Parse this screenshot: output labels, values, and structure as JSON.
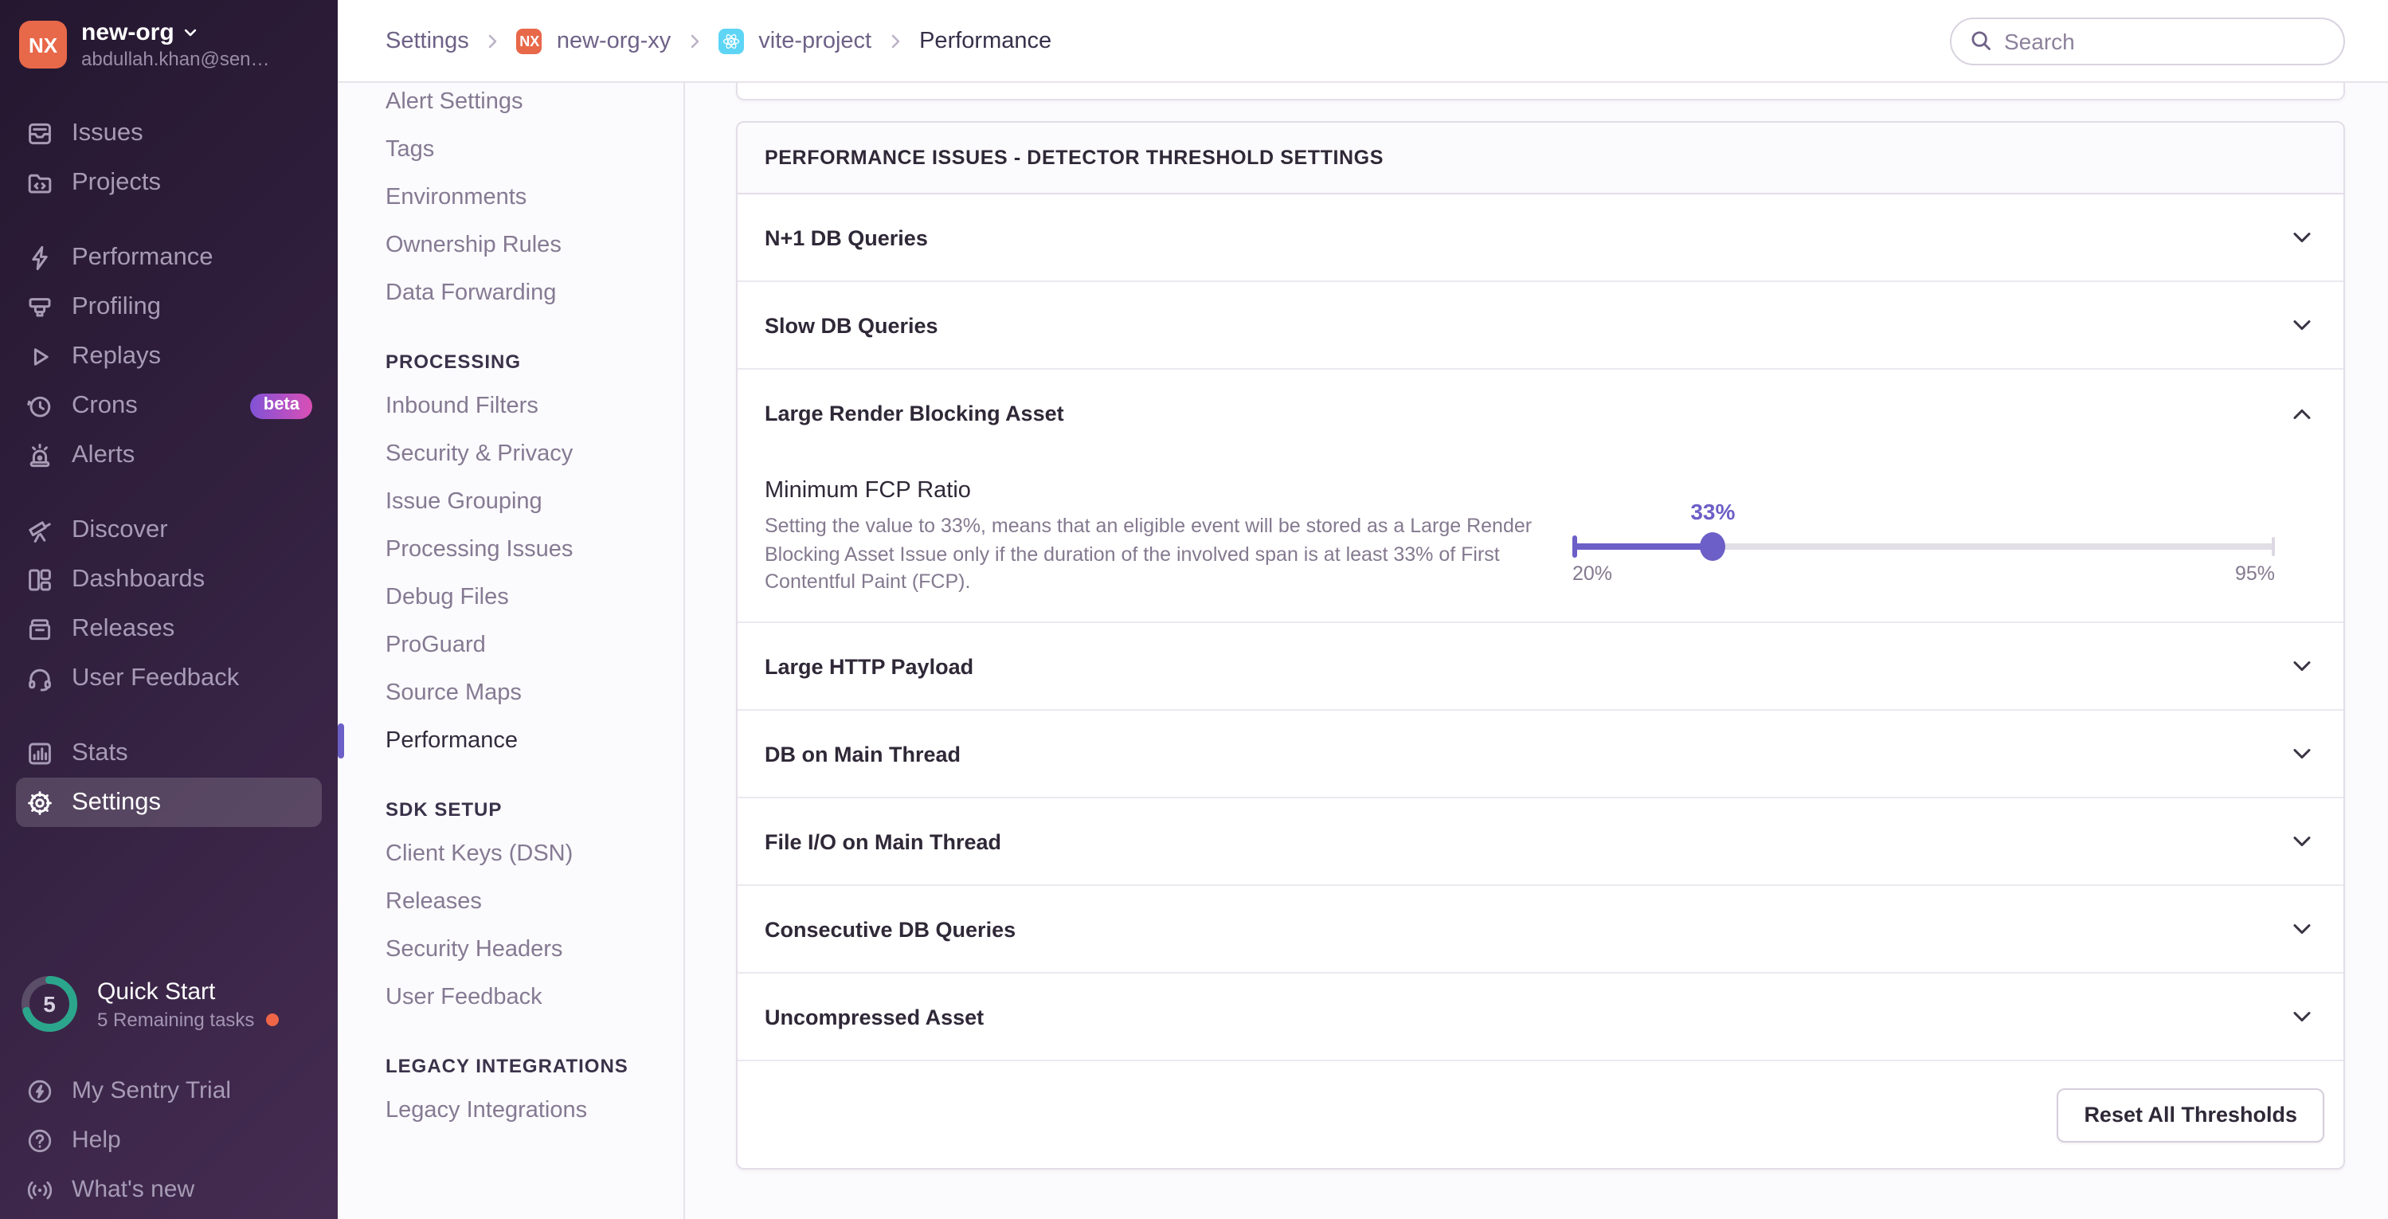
{
  "org": {
    "initials": "NX",
    "name": "new-org",
    "email": "abdullah.khan@sen…"
  },
  "topbar": {
    "breadcrumb": [
      "Settings",
      "new-org-xy",
      "vite-project",
      "Performance"
    ],
    "search_placeholder": "Search"
  },
  "sidebar": {
    "items": [
      {
        "label": "Issues"
      },
      {
        "label": "Projects"
      },
      {
        "label": "Performance"
      },
      {
        "label": "Profiling"
      },
      {
        "label": "Replays"
      },
      {
        "label": "Crons",
        "badge": "beta"
      },
      {
        "label": "Alerts"
      },
      {
        "label": "Discover"
      },
      {
        "label": "Dashboards"
      },
      {
        "label": "Releases"
      },
      {
        "label": "User Feedback"
      },
      {
        "label": "Stats"
      },
      {
        "label": "Settings",
        "active": true
      }
    ],
    "quick_start": {
      "count": "5",
      "title": "Quick Start",
      "subtitle": "5 Remaining tasks"
    },
    "footer_items": [
      {
        "label": "My Sentry Trial"
      },
      {
        "label": "Help"
      },
      {
        "label": "What's new"
      }
    ]
  },
  "settings_nav": {
    "items": [
      {
        "label": "Alert Settings"
      },
      {
        "label": "Tags"
      },
      {
        "label": "Environments"
      },
      {
        "label": "Ownership Rules"
      },
      {
        "label": "Data Forwarding"
      },
      {
        "label": "PROCESSING",
        "type": "header"
      },
      {
        "label": "Inbound Filters"
      },
      {
        "label": "Security & Privacy"
      },
      {
        "label": "Issue Grouping"
      },
      {
        "label": "Processing Issues"
      },
      {
        "label": "Debug Files"
      },
      {
        "label": "ProGuard"
      },
      {
        "label": "Source Maps"
      },
      {
        "label": "Performance",
        "active": true
      },
      {
        "label": "SDK SETUP",
        "type": "header"
      },
      {
        "label": "Client Keys (DSN)"
      },
      {
        "label": "Releases"
      },
      {
        "label": "Security Headers"
      },
      {
        "label": "User Feedback"
      },
      {
        "label": "LEGACY INTEGRATIONS",
        "type": "header"
      },
      {
        "label": "Legacy Integrations"
      }
    ]
  },
  "detectors": {
    "panel_title": "PERFORMANCE ISSUES - DETECTOR THRESHOLD SETTINGS",
    "rows": [
      {
        "title": "N+1 DB Queries",
        "expanded": false
      },
      {
        "title": "Slow DB Queries",
        "expanded": false
      },
      {
        "title": "Large Render Blocking Asset",
        "expanded": true
      },
      {
        "title": "Large HTTP Payload",
        "expanded": false
      },
      {
        "title": "DB on Main Thread",
        "expanded": false
      },
      {
        "title": "File I/O on Main Thread",
        "expanded": false
      },
      {
        "title": "Consecutive DB Queries",
        "expanded": false
      },
      {
        "title": "Uncompressed Asset",
        "expanded": false
      }
    ],
    "expanded": {
      "label": "Minimum FCP Ratio",
      "description": "Setting the value to 33%, means that an eligible event will be stored as a Large Render Blocking Asset Issue only if the duration of the involved span is at least 33% of First Contentful Paint (FCP).",
      "slider": {
        "value": "33%",
        "min": "20%",
        "max": "95%",
        "fraction": 0.2
      }
    },
    "reset_button": "Reset All Thresholds"
  },
  "colors": {
    "accent": "#6C5FC7",
    "org_avatar": "#E8684A",
    "react_badge": "#5ED5F5",
    "quickstart_ring": "#2BA68C",
    "notification_dot": "#EE6547",
    "beta_gradient_start": "#8152D6",
    "beta_gradient_end": "#D94FB5"
  }
}
